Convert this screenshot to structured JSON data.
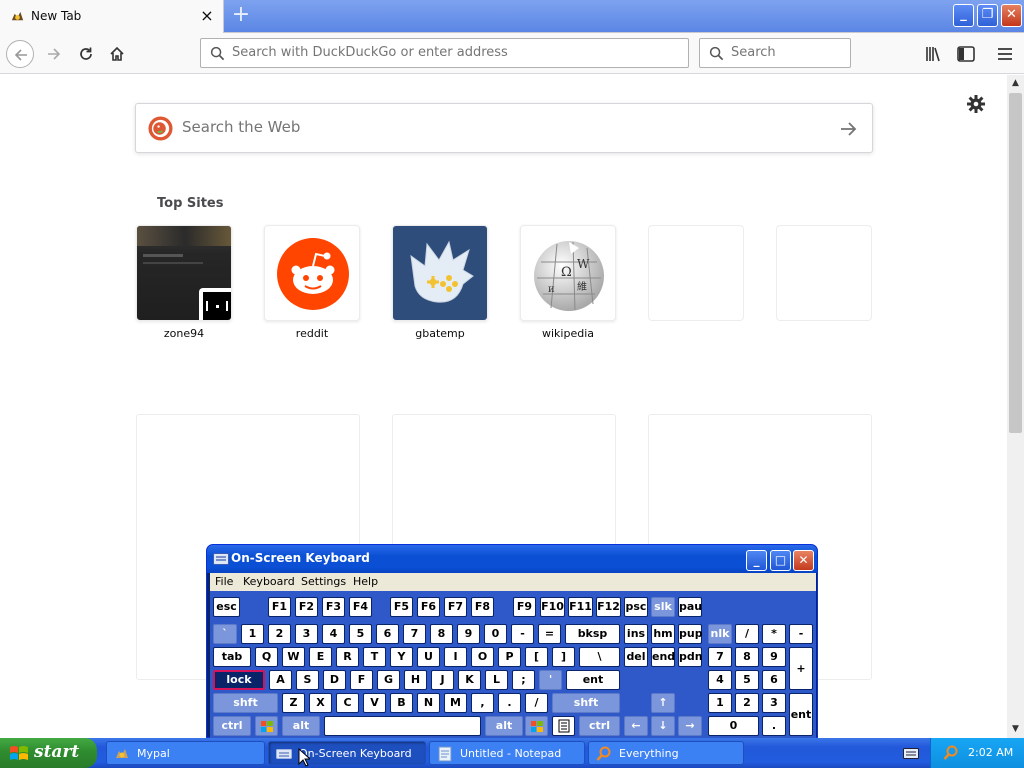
{
  "browser": {
    "tab_title": "New Tab",
    "tab_close": "×",
    "new_tab": "+",
    "window_buttons": {
      "minimize": "_",
      "maximize": "❐",
      "close": "✕"
    },
    "url_placeholder": "Search with DuckDuckGo or enter address",
    "search_placeholder": "Search"
  },
  "newtab": {
    "web_search_placeholder": "Search the Web",
    "top_sites_heading": "Top Sites",
    "sites": [
      {
        "label": "zone94"
      },
      {
        "label": "reddit"
      },
      {
        "label": "gbatemp"
      },
      {
        "label": "wikipedia"
      },
      {
        "label": ""
      },
      {
        "label": ""
      }
    ]
  },
  "osk": {
    "title": "On-Screen Keyboard",
    "menu": [
      "File",
      "Keyboard",
      "Settings",
      "Help"
    ],
    "window_buttons": {
      "minimize": "_",
      "maximize": "□",
      "close": "✕"
    },
    "keys": {
      "esc": "esc",
      "f1": "F1",
      "f2": "F2",
      "f3": "F3",
      "f4": "F4",
      "f5": "F5",
      "f6": "F6",
      "f7": "F7",
      "f8": "F8",
      "f9": "F9",
      "f10": "F10",
      "f11": "F11",
      "f12": "F12",
      "psc": "psc",
      "slk": "slk",
      "pau": "pau",
      "backtick": "`",
      "n1": "1",
      "n2": "2",
      "n3": "3",
      "n4": "4",
      "n5": "5",
      "n6": "6",
      "n7": "7",
      "n8": "8",
      "n9": "9",
      "n0": "0",
      "minus": "-",
      "equals": "=",
      "bksp": "bksp",
      "ins": "ins",
      "hm": "hm",
      "pup": "pup",
      "nlk": "nlk",
      "np_div": "/",
      "np_mul": "*",
      "np_sub": "-",
      "tab": "tab",
      "q": "Q",
      "w": "W",
      "e": "E",
      "r": "R",
      "t": "T",
      "y": "Y",
      "u": "U",
      "i": "I",
      "o": "O",
      "p": "P",
      "lbracket": "[",
      "rbracket": "]",
      "backslash": "\\",
      "del": "del",
      "end": "end",
      "pdn": "pdn",
      "np7": "7",
      "np8": "8",
      "np9": "9",
      "np_add": "+",
      "lock": "lock",
      "a": "A",
      "s": "S",
      "d": "D",
      "f": "F",
      "g": "G",
      "h": "H",
      "j": "J",
      "k": "K",
      "l": "L",
      "semicolon": ";",
      "quote": "'",
      "ent": "ent",
      "np4": "4",
      "np5": "5",
      "np6": "6",
      "shft": "shft",
      "z": "Z",
      "x": "X",
      "c": "C",
      "v": "V",
      "b": "B",
      "n": "N",
      "m": "M",
      "comma": ",",
      "period": ".",
      "slash": "/",
      "shft_r": "shft",
      "up": "↑",
      "np1": "1",
      "np2": "2",
      "np3": "3",
      "np_ent": "ent",
      "ctrl": "ctrl",
      "alt": "alt",
      "alt_r": "alt",
      "ctrl_r": "ctrl",
      "left": "←",
      "down": "↓",
      "right": "→",
      "np0": "0",
      "np_dot": "."
    }
  },
  "taskbar": {
    "start": "start",
    "tasks": [
      {
        "label": "Mypal"
      },
      {
        "label": "On-Screen Keyboard"
      },
      {
        "label": "Untitled - Notepad"
      },
      {
        "label": "Everything"
      }
    ],
    "clock": "2:02 AM"
  },
  "colors": {
    "xp_blue": "#225cdf",
    "start_green": "#3a9a3a",
    "reddit_orange": "#ff4500",
    "gbatemp_blue": "#2e4d7a",
    "osk_active_key": "#0a246a"
  }
}
